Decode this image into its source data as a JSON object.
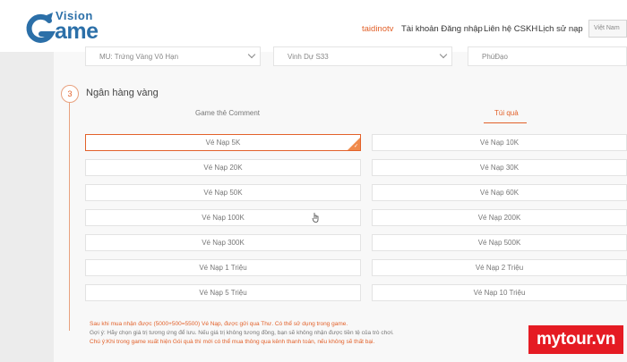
{
  "brand": {
    "top": "Vision",
    "bottom": "ame",
    "g_color": "#2b6fa8"
  },
  "nav": {
    "username": "taidinotv",
    "account": "Tài khoản Đăng nhập",
    "contact": "Liên hệ CSKH",
    "history": "Lịch sử nạp",
    "language": "Việt Nam"
  },
  "selects": {
    "server": "MU: Trứng Vàng Vô Hạn",
    "character": "Vinh Dự S33",
    "role": "PhúĐạo"
  },
  "step": {
    "number": "3",
    "title": "Ngân hàng vàng"
  },
  "tabs": {
    "comment": "Game thẻ Comment",
    "gift": "Túi quà"
  },
  "options_left": [
    "Vé Nạp 5K",
    "Vé Nạp 20K",
    "Vé Nạp 50K",
    "Vé Nạp 100K",
    "Vé Nạp 300K",
    "Vé Nạp 1 Triệu",
    "Vé Nạp 5 Triệu"
  ],
  "options_right": [
    "Vé Nạp 10K",
    "Vé Nạp 30K",
    "Vé Nạp 60K",
    "Vé Nạp 200K",
    "Vé Nạp 500K",
    "Vé Nạp 2 Triệu",
    "Vé Nạp 10 Triệu"
  ],
  "selected_option": "Vé Nạp 5K",
  "notes": {
    "line1": "Sau khi mua nhận được (5000+500=5500) Vé Nạp, được gửi qua Thư. Có thể sử dụng trong game.",
    "line2": "Gợi ý: Hãy chọn giá trị tương ứng để lưu. Nếu giá trị không tương đồng, bạn sẽ không nhận được tiền tệ của trò chơi.",
    "line3": "Chú ý:Khi trong game xuất hiện Gói quà thì mới có thể mua thông qua kênh thanh toán, nếu không sẽ thất bại."
  },
  "watermark": "mytour.vn",
  "colors": {
    "accent": "#e2612a",
    "brand": "#2b6fa8",
    "watermark": "#e51b23"
  }
}
